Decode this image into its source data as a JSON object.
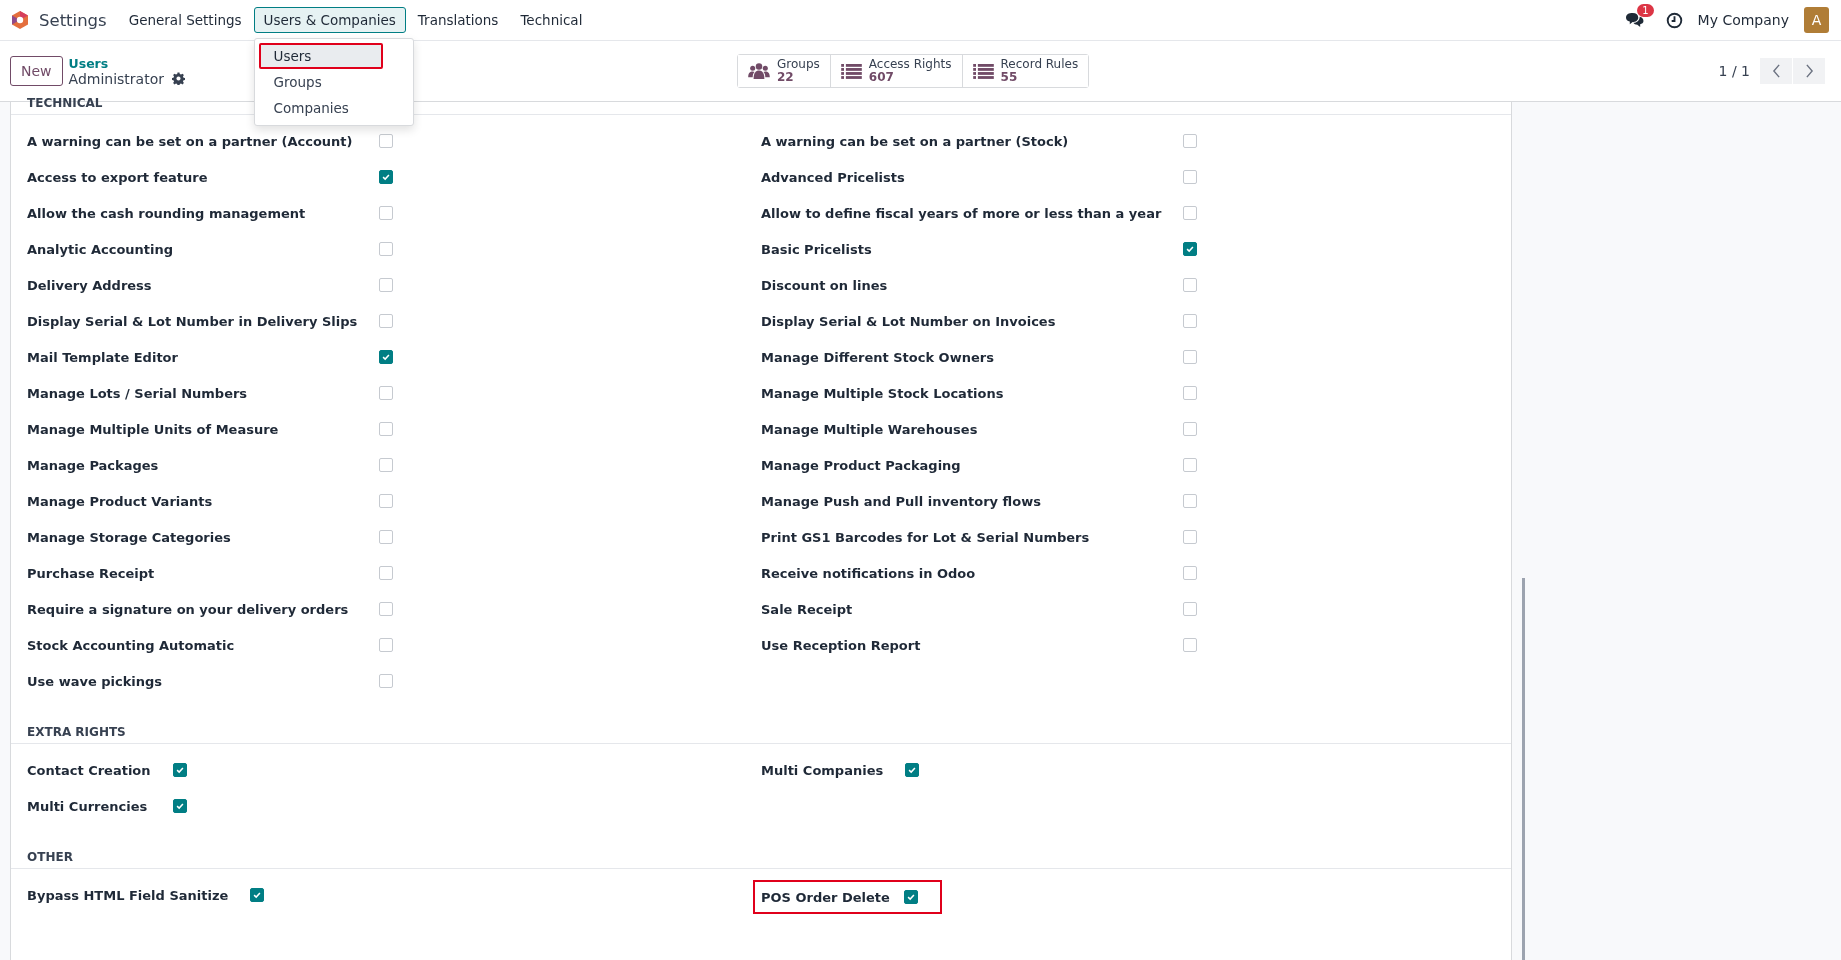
{
  "navbar": {
    "app_name": "Settings",
    "menus": [
      {
        "label": "General Settings",
        "selected": false
      },
      {
        "label": "Users & Companies",
        "selected": true
      },
      {
        "label": "Translations",
        "selected": false
      },
      {
        "label": "Technical",
        "selected": false
      }
    ],
    "dropdown": [
      {
        "label": "Users",
        "selected": true,
        "highlighted": true
      },
      {
        "label": "Groups",
        "selected": false,
        "highlighted": false
      },
      {
        "label": "Companies",
        "selected": false,
        "highlighted": false
      }
    ],
    "messages_badge": "1",
    "company": "My Company",
    "avatar": "A"
  },
  "control_panel": {
    "new_button": "New",
    "breadcrumb": "Users",
    "record": "Administrator",
    "smart_buttons": [
      {
        "kind": "users",
        "label": "Groups",
        "count": "22"
      },
      {
        "kind": "list",
        "label": "Access Rights",
        "count": "607"
      },
      {
        "kind": "list",
        "label": "Record Rules",
        "count": "55"
      }
    ],
    "pager": "1 / 1"
  },
  "sections": [
    {
      "title": "TECHNICAL",
      "columns": [
        [
          {
            "label": "A warning can be set on a partner (Account)",
            "checked": false,
            "highlighted": false
          },
          {
            "label": "Access to export feature",
            "checked": true,
            "highlighted": false
          },
          {
            "label": "Allow the cash rounding management",
            "checked": false,
            "highlighted": false
          },
          {
            "label": "Analytic Accounting",
            "checked": false,
            "highlighted": false
          },
          {
            "label": "Delivery Address",
            "checked": false,
            "highlighted": false
          },
          {
            "label": "Display Serial & Lot Number in Delivery Slips",
            "checked": false,
            "highlighted": false
          },
          {
            "label": "Mail Template Editor",
            "checked": true,
            "highlighted": false
          },
          {
            "label": "Manage Lots / Serial Numbers",
            "checked": false,
            "highlighted": false
          },
          {
            "label": "Manage Multiple Units of Measure",
            "checked": false,
            "highlighted": false
          },
          {
            "label": "Manage Packages",
            "checked": false,
            "highlighted": false
          },
          {
            "label": "Manage Product Variants",
            "checked": false,
            "highlighted": false
          },
          {
            "label": "Manage Storage Categories",
            "checked": false,
            "highlighted": false
          },
          {
            "label": "Purchase Receipt",
            "checked": false,
            "highlighted": false
          },
          {
            "label": "Require a signature on your delivery orders",
            "checked": false,
            "highlighted": false
          },
          {
            "label": "Stock Accounting Automatic",
            "checked": false,
            "highlighted": false
          },
          {
            "label": "Use wave pickings",
            "checked": false,
            "highlighted": false
          }
        ],
        [
          {
            "label": "A warning can be set on a partner (Stock)",
            "checked": false,
            "highlighted": false
          },
          {
            "label": "Advanced Pricelists",
            "checked": false,
            "highlighted": false
          },
          {
            "label": "Allow to define fiscal years of more or less than a year",
            "checked": false,
            "highlighted": false
          },
          {
            "label": "Basic Pricelists",
            "checked": true,
            "highlighted": false
          },
          {
            "label": "Discount on lines",
            "checked": false,
            "highlighted": false
          },
          {
            "label": "Display Serial & Lot Number on Invoices",
            "checked": false,
            "highlighted": false
          },
          {
            "label": "Manage Different Stock Owners",
            "checked": false,
            "highlighted": false
          },
          {
            "label": "Manage Multiple Stock Locations",
            "checked": false,
            "highlighted": false
          },
          {
            "label": "Manage Multiple Warehouses",
            "checked": false,
            "highlighted": false
          },
          {
            "label": "Manage Product Packaging",
            "checked": false,
            "highlighted": false
          },
          {
            "label": "Manage Push and Pull inventory flows",
            "checked": false,
            "highlighted": false
          },
          {
            "label": "Print GS1 Barcodes for Lot & Serial Numbers",
            "checked": false,
            "highlighted": false
          },
          {
            "label": "Receive notifications in Odoo",
            "checked": false,
            "highlighted": false
          },
          {
            "label": "Sale Receipt",
            "checked": false,
            "highlighted": false
          },
          {
            "label": "Use Reception Report",
            "checked": false,
            "highlighted": false
          }
        ]
      ]
    },
    {
      "title": "EXTRA RIGHTS",
      "columns": [
        [
          {
            "label": "Contact Creation",
            "checked": true,
            "highlighted": false
          },
          {
            "label": "Multi Currencies",
            "checked": true,
            "highlighted": false
          }
        ],
        [
          {
            "label": "Multi Companies",
            "checked": true,
            "highlighted": false
          }
        ]
      ]
    },
    {
      "title": "OTHER",
      "columns": [
        [
          {
            "label": "Bypass HTML Field Sanitize",
            "checked": true,
            "highlighted": false
          }
        ],
        [
          {
            "label": "POS Order Delete",
            "checked": true,
            "highlighted": true
          }
        ]
      ]
    }
  ]
}
